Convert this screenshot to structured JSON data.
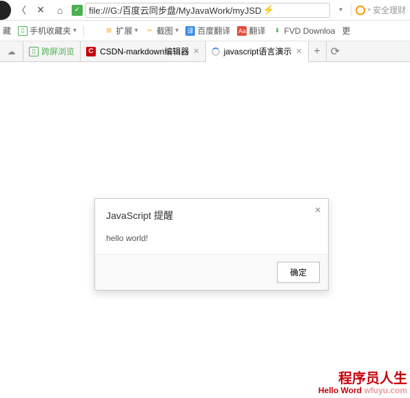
{
  "addressBar": {
    "url": "file:///G:/百度云同步盘/MyJavaWork/myJSD",
    "searchPlaceholder": "安全理财"
  },
  "bookmarkBar": {
    "left": "藏",
    "mobileFav": "手机收藏夹",
    "extensions": "扩展",
    "screenshot": "截图",
    "translate": "百度翻译",
    "aaTranslate": "翻译",
    "fvd": "FVD Downloa",
    "more": "更"
  },
  "tabs": {
    "pinned": {
      "kuaping": "跨屏浏览"
    },
    "items": [
      {
        "label": "CSDN-markdown编辑器"
      },
      {
        "label": "javascript语言演示"
      }
    ]
  },
  "dialog": {
    "title": "JavaScript 提醒",
    "message": "hello world!",
    "okLabel": "确定"
  },
  "watermark": {
    "line1": "程序员人生",
    "line2a": "Hello Word",
    "line2b": "wfuyu.com"
  }
}
